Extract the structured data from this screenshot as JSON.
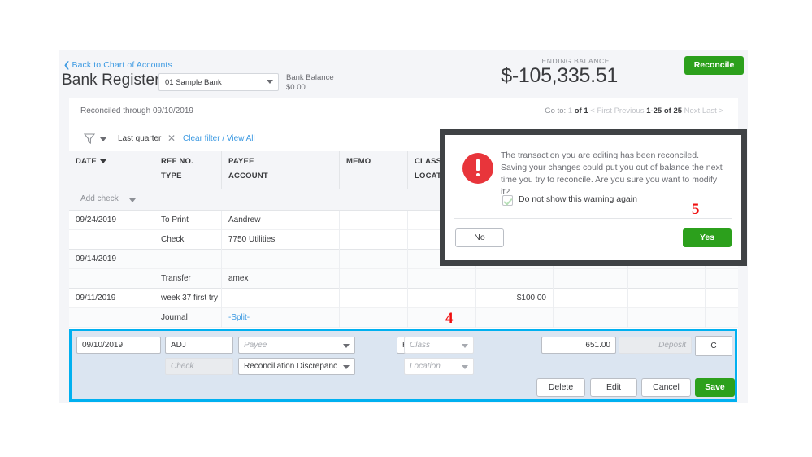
{
  "header": {
    "back_link": "Back to Chart of Accounts",
    "back_chevron": "chevron-left-icon",
    "title": "Bank Register",
    "account_selected": "01 Sample Bank",
    "bank_balance_label": "Bank Balance",
    "bank_balance_value": "$0.00",
    "ending_balance_label": "ENDING BALANCE",
    "ending_balance_value": "$-105,335.51",
    "reconcile_button": "Reconcile",
    "accent_green": "#2ca01c",
    "link_blue": "#3d9ae2"
  },
  "card": {
    "reconciled_through": "Reconciled through 09/10/2019",
    "pager": {
      "goto_label": "Go to:",
      "page": "1",
      "of": "of 1",
      "first": "< First",
      "previous": "Previous",
      "range": "1-25 of 25",
      "next": "Next",
      "last": "Last >"
    },
    "filter": {
      "funnel_icon": "filter-funnel-icon",
      "chip_label": "Last quarter",
      "chip_close_icon": "close-x-icon",
      "clear_link": "Clear filter / View All"
    },
    "add_check": "Add check"
  },
  "table": {
    "columns": [
      {
        "top": "DATE",
        "bottom": "",
        "sortable": true
      },
      {
        "top": "REF NO.",
        "bottom": "TYPE",
        "sortable": false
      },
      {
        "top": "PAYEE",
        "bottom": "ACCOUNT",
        "sortable": false
      },
      {
        "top": "MEMO",
        "bottom": "",
        "sortable": false
      },
      {
        "top": "CLASS",
        "bottom": "LOCATION",
        "sortable": false
      },
      {
        "top": "",
        "bottom": "",
        "sortable": false
      },
      {
        "top": "",
        "bottom": "",
        "sortable": false
      },
      {
        "top": "",
        "bottom": "",
        "sortable": false
      },
      {
        "top": "",
        "bottom": "",
        "sortable": false
      }
    ],
    "rows": [
      {
        "date": "09/24/2019",
        "ref": "To Print",
        "payee": "Aandrew",
        "memo": "",
        "class": "",
        "payment": "",
        "deposit": "",
        "check": "",
        "balance": "",
        "payee_is_link": false
      },
      {
        "date": "",
        "ref": "Check",
        "payee": "7750 Utilities",
        "memo": "",
        "class": "",
        "payment": "",
        "deposit": "",
        "check": "",
        "balance": "",
        "payee_is_link": false
      },
      {
        "date": "09/14/2019",
        "ref": "",
        "payee": "",
        "memo": "",
        "class": "",
        "payment": "",
        "deposit": "",
        "check": "",
        "balance": "",
        "payee_is_link": false
      },
      {
        "date": "",
        "ref": "Transfer",
        "payee": "amex",
        "memo": "",
        "class": "",
        "payment": "",
        "deposit": "",
        "check": "",
        "balance": "",
        "payee_is_link": false
      },
      {
        "date": "09/11/2019",
        "ref": "week 37 first try",
        "payee": "",
        "memo": "",
        "class": "",
        "payment": "$100.00",
        "deposit": "",
        "check": "",
        "balance": "",
        "payee_is_link": false
      },
      {
        "date": "",
        "ref": "Journal",
        "payee": "-Split-",
        "memo": "",
        "class": "",
        "payment": "",
        "deposit": "",
        "check": "",
        "balance": "",
        "payee_is_link": true
      }
    ]
  },
  "edit_row": {
    "date": "09/10/2019",
    "ref_no": "ADJ",
    "type": "Check",
    "payee_placeholder": "Payee",
    "account": "Reconciliation Discrepanc",
    "memo": "Reconcile Adjustm",
    "class_placeholder": "Class",
    "location_placeholder": "Location",
    "payment": "651.00",
    "deposit_placeholder": "Deposit",
    "cleared_status": "C",
    "buttons": {
      "delete": "Delete",
      "edit": "Edit",
      "cancel": "Cancel",
      "save": "Save"
    }
  },
  "modal": {
    "icon": "alert-exclamation-icon",
    "message": "The transaction you are editing has been reconciled. Saving your changes could put you out of balance the next time you try to reconcile. Are you sure you want to modify it?",
    "checkbox_label": "Do not show this warning again",
    "checkbox_checked": true,
    "no_button": "No",
    "yes_button": "Yes",
    "border_color": "#3f4245",
    "alert_color": "#e8353b"
  },
  "annotations": {
    "four": "4",
    "five": "5",
    "color": "#f01010"
  }
}
